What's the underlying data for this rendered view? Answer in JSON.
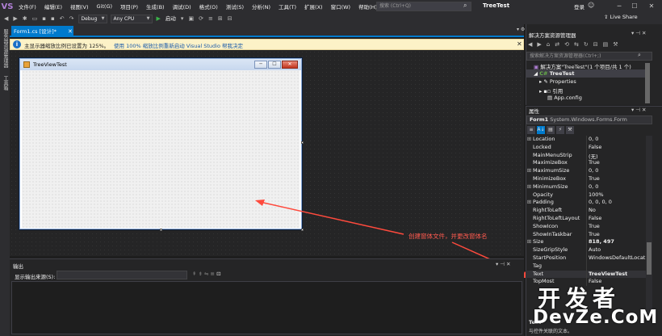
{
  "menubar": {
    "logo": "VS",
    "items": [
      "文件(F)",
      "编辑(E)",
      "视图(V)",
      "Git(G)",
      "项目(P)",
      "生成(B)",
      "调试(D)",
      "格式(O)",
      "测试(S)",
      "分析(N)",
      "工具(T)",
      "扩展(X)",
      "窗口(W)",
      "帮助(H)"
    ],
    "search_placeholder": "搜索 (Ctrl+Q)",
    "app_title": "TreeTest",
    "login": "登录"
  },
  "toolbar": {
    "config": "Debug",
    "platform": "Any CPU",
    "start_label": "启动",
    "live_share": "Live Share"
  },
  "left_strip": {
    "items": [
      "服务器资源管理器",
      "工具箱"
    ]
  },
  "document": {
    "tab_label": "Form1.cs [设计]*",
    "info_text": "主显示器缩放比例已设置为 125%。",
    "info_link1": "使用 100% 缩放比例重新启动 Visual Studio",
    "info_link2": "帮我决定"
  },
  "form": {
    "title": "TreeViewTest"
  },
  "annotation": {
    "text": "创建窗体文件，并更改窗体名"
  },
  "output": {
    "title": "输出",
    "source_label": "显示输出来源(S):"
  },
  "solution": {
    "title": "解决方案资源管理器",
    "search_placeholder": "搜索解决方案资源管理器(Ctrl+;)",
    "solution_item": "解决方案\"TreeTest\"(1 个项目/共 1 个)",
    "project_item": "TreeTest",
    "children": [
      "Properties",
      "引用",
      "App.config"
    ]
  },
  "properties": {
    "title": "属性",
    "object_name": "Form1",
    "object_type": "System.Windows.Forms.Form",
    "rows": [
      {
        "expand": "⊞",
        "name": "Location",
        "value": "0, 0",
        "bold": false
      },
      {
        "expand": "",
        "name": "Locked",
        "value": "False",
        "bold": false
      },
      {
        "expand": "",
        "name": "MainMenuStrip",
        "value": "(无)",
        "bold": false
      },
      {
        "expand": "",
        "name": "MaximizeBox",
        "value": "True",
        "bold": false
      },
      {
        "expand": "⊞",
        "name": "MaximumSize",
        "value": "0, 0",
        "bold": false
      },
      {
        "expand": "",
        "name": "MinimizeBox",
        "value": "True",
        "bold": false
      },
      {
        "expand": "⊞",
        "name": "MinimumSize",
        "value": "0, 0",
        "bold": false
      },
      {
        "expand": "",
        "name": "Opacity",
        "value": "100%",
        "bold": false
      },
      {
        "expand": "⊞",
        "name": "Padding",
        "value": "0, 0, 0, 0",
        "bold": false
      },
      {
        "expand": "",
        "name": "RightToLeft",
        "value": "No",
        "bold": false
      },
      {
        "expand": "",
        "name": "RightToLeftLayout",
        "value": "False",
        "bold": false
      },
      {
        "expand": "",
        "name": "ShowIcon",
        "value": "True",
        "bold": false
      },
      {
        "expand": "",
        "name": "ShowInTaskbar",
        "value": "True",
        "bold": false
      },
      {
        "expand": "⊞",
        "name": "Size",
        "value": "818, 497",
        "bold": true
      },
      {
        "expand": "",
        "name": "SizeGripStyle",
        "value": "Auto",
        "bold": false
      },
      {
        "expand": "",
        "name": "StartPosition",
        "value": "WindowsDefaultLocat",
        "bold": false
      },
      {
        "expand": "",
        "name": "Tag",
        "value": "",
        "bold": false
      },
      {
        "expand": "",
        "name": "Text",
        "value": "TreeViewTest",
        "bold": true
      },
      {
        "expand": "",
        "name": "TopMost",
        "value": "False",
        "bold": false
      }
    ],
    "desc_title": "Text",
    "desc_text": "与控件关联的文本。"
  },
  "watermark": {
    "cn": "开发者",
    "en": "DevZe.CoM"
  },
  "colors": {
    "accent": "#007acc",
    "annotation": "#ff5a4f",
    "infobar": "#fcf2c7"
  }
}
